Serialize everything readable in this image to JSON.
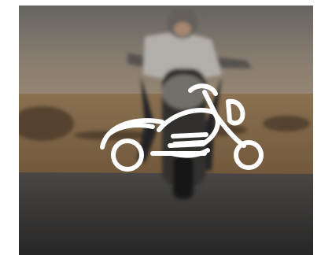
{
  "card": {
    "image_subject": "rider-on-motorcycle-photo",
    "icon": "motorcycle-icon",
    "icon_color": "#ffffff"
  },
  "colors": {
    "sky": "#8f8c86",
    "haze": "#b7a58f",
    "field": "#9b7a55",
    "road": "#3f3f3f",
    "overlay": "#000000"
  }
}
